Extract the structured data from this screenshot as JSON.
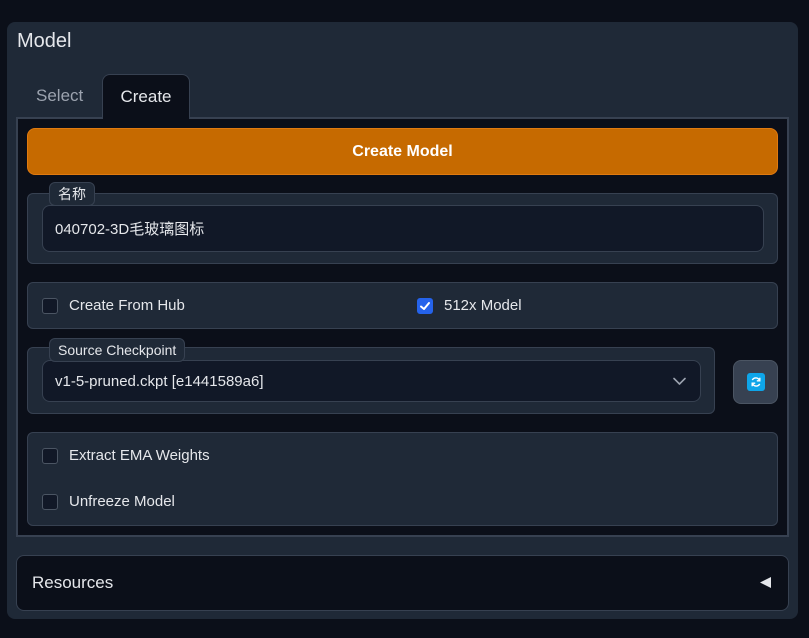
{
  "section_title": "Model",
  "tabs": [
    {
      "label": "Select",
      "active": false
    },
    {
      "label": "Create",
      "active": true
    }
  ],
  "create_button_label": "Create Model",
  "name_field": {
    "label": "名称",
    "value": "040702-3D毛玻璃图标"
  },
  "create_from_hub": {
    "label": "Create From Hub",
    "checked": false
  },
  "model_512x": {
    "label": "512x Model",
    "checked": true
  },
  "source_checkpoint": {
    "label": "Source Checkpoint",
    "selected": "v1-5-pruned.ckpt [e1441589a6]"
  },
  "extract_ema": {
    "label": "Extract EMA Weights",
    "checked": false
  },
  "unfreeze_model": {
    "label": "Unfreeze Model",
    "checked": false
  },
  "resources_label": "Resources",
  "colors": {
    "accent": "#c66a00",
    "checkbox_checked": "#2563eb",
    "refresh_icon": "#0ea5e9"
  },
  "icons": {
    "refresh": "refresh-icon",
    "dropdown": "chevron-down-icon",
    "collapse": "triangle-left-icon",
    "check": "checkmark-icon"
  }
}
